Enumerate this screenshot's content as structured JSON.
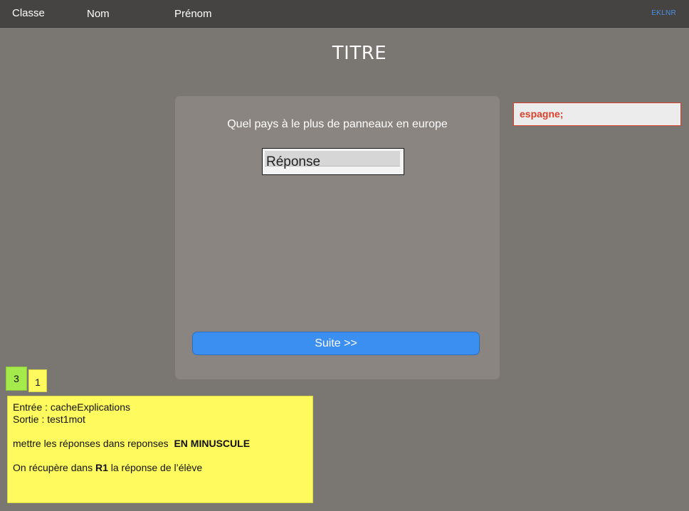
{
  "topbar": {
    "classe_label": "Classe",
    "nom_label": "Nom",
    "prenom_label": "Prénom",
    "code": "EKLNR"
  },
  "title": "TITRE",
  "question": {
    "text": "Quel pays à le plus de panneaux en europe",
    "answer_placeholder": "Réponse",
    "submit_label": "Suite >>"
  },
  "reply_tag": "espagne;",
  "badges": {
    "green": "3",
    "yellow": "1"
  },
  "note": {
    "line1": "Entrée : cacheExplications",
    "line2": "Sortie : test1mot",
    "line3_pre": "mettre les réponses dans reponses  ",
    "line3_bold": "EN MINUSCULE",
    "line4_pre": "On récupère dans ",
    "line4_bold": "R1",
    "line4_post": " la réponse de l’élève"
  },
  "colors": {
    "background": "#7a7672",
    "topbar": "#454443",
    "card": "#8a8581",
    "accent_blue": "#3b8ff0",
    "reply_red": "#d9412e",
    "note_yellow": "#fffb5e",
    "badge_green": "#a4ea4b"
  }
}
